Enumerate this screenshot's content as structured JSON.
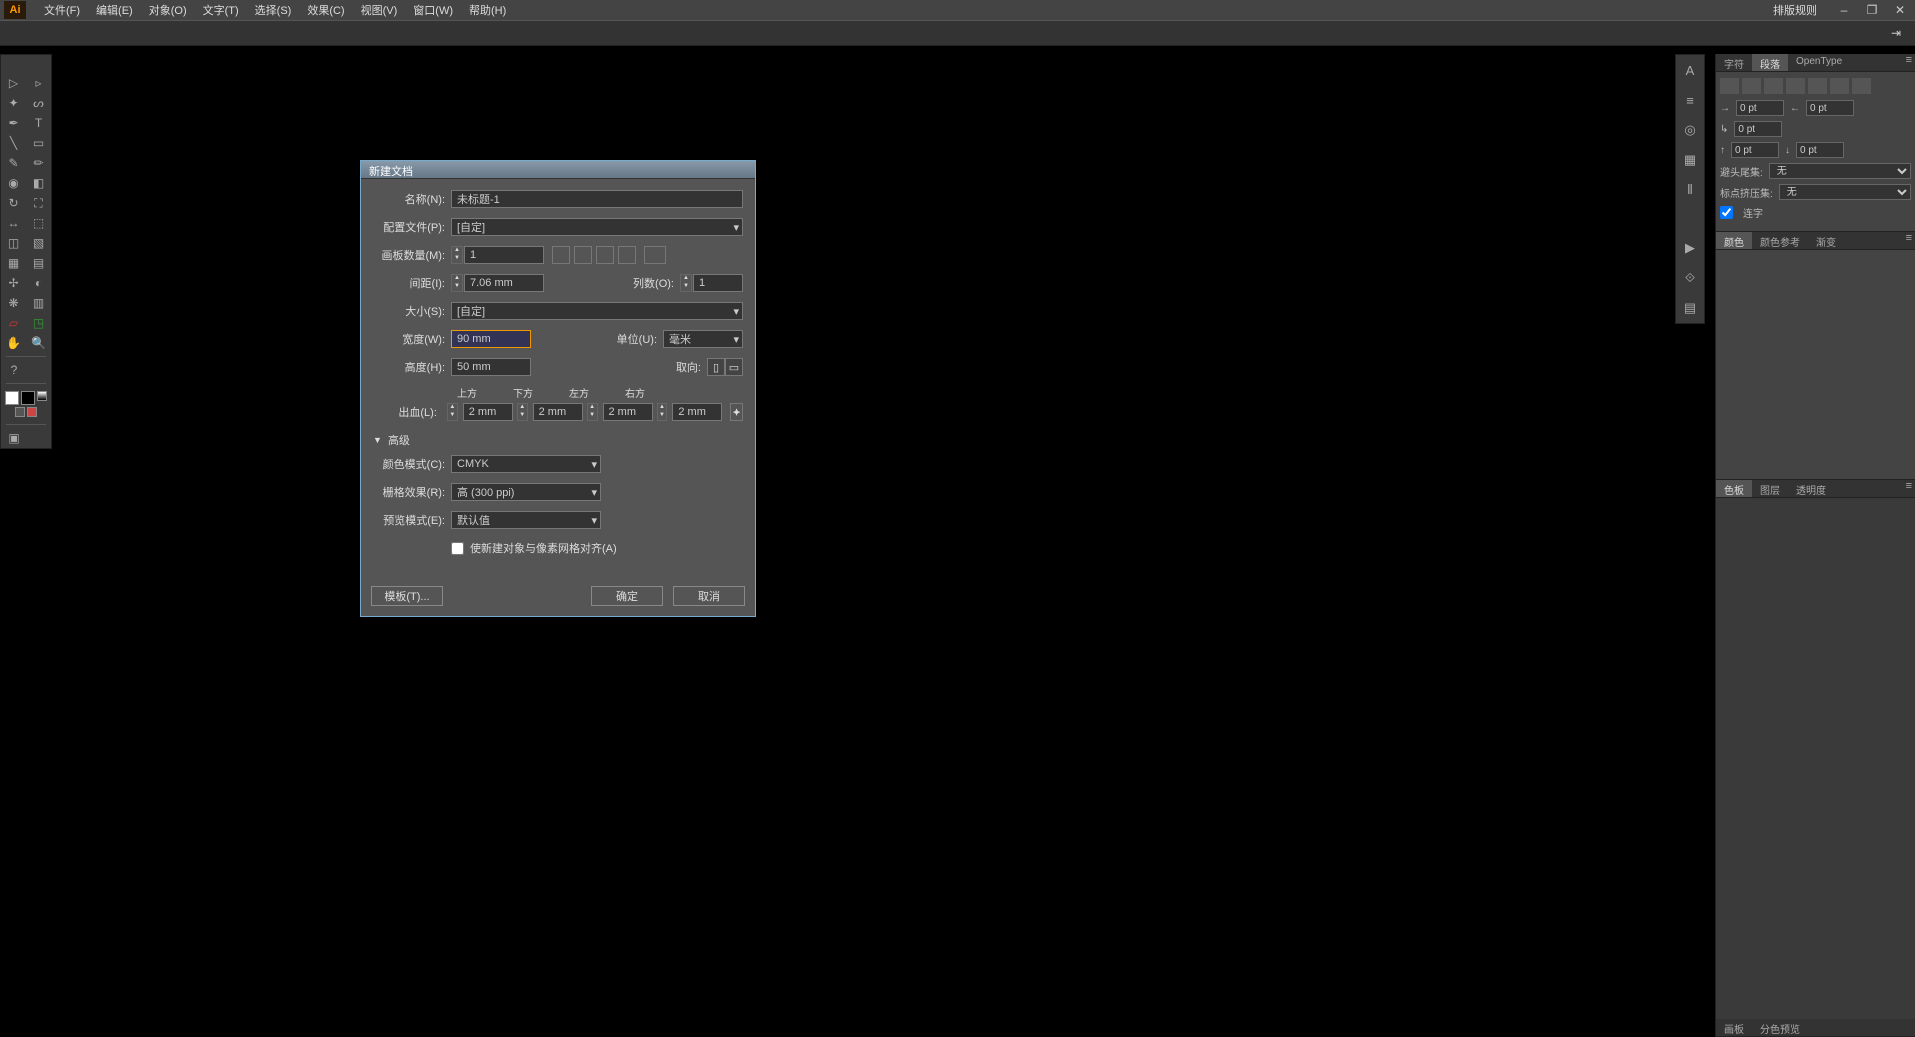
{
  "app": {
    "icon_text": "Ai"
  },
  "menu": {
    "file": "文件(F)",
    "edit": "编辑(E)",
    "object": "对象(O)",
    "type": "文字(T)",
    "select": "选择(S)",
    "effect": "效果(C)",
    "view": "视图(V)",
    "window": "窗口(W)",
    "help": "帮助(H)",
    "layout_rules": "排版规则"
  },
  "right_panels": {
    "p1": {
      "t1": "字符",
      "t2": "段落",
      "t3": "OpenType",
      "pt1": "0 pt",
      "pt2": "0 pt",
      "pt3": "0 pt",
      "pt4": "0 pt",
      "dropdown_label1": "避头尾集:",
      "dropdown_val1": "无",
      "dropdown_label2": "标点挤压集:",
      "dropdown_val2": "无",
      "checkbox": "连字"
    },
    "p2": {
      "t1": "颜色",
      "t2": "颜色参考",
      "t3": "渐变"
    },
    "p3": {
      "t1": "色板",
      "t2": "图层",
      "t3": "透明度",
      "footer1": "画板",
      "footer2": "分色预览"
    }
  },
  "dialog": {
    "title": "新建文档",
    "labels": {
      "name": "名称(N):",
      "profile": "配置文件(P):",
      "artboards": "画板数量(M):",
      "spacing": "间距(I):",
      "columns": "列数(O):",
      "size": "大小(S):",
      "width": "宽度(W):",
      "units": "单位(U):",
      "height": "高度(H):",
      "orient": "取向:",
      "bleed": "出血(L):",
      "top": "上方",
      "bottom": "下方",
      "left": "左方",
      "right": "右方",
      "advanced": "高级",
      "colormode": "颜色模式(C):",
      "raster": "栅格效果(R):",
      "preview": "预览模式(E):",
      "pixelgrid": "使新建对象与像素网格对齐(A)"
    },
    "values": {
      "name": "未标题-1",
      "profile": "[自定]",
      "artboards": "1",
      "spacing": "7.06 mm",
      "columns": "1",
      "size": "[自定]",
      "width": "90 mm",
      "units": "毫米",
      "height": "50 mm",
      "bleed_top": "2 mm",
      "bleed_bottom": "2 mm",
      "bleed_left": "2 mm",
      "bleed_right": "2 mm",
      "colormode": "CMYK",
      "raster": "高 (300 ppi)",
      "preview": "默认值"
    },
    "buttons": {
      "template": "模板(T)...",
      "ok": "确定",
      "cancel": "取消"
    }
  }
}
